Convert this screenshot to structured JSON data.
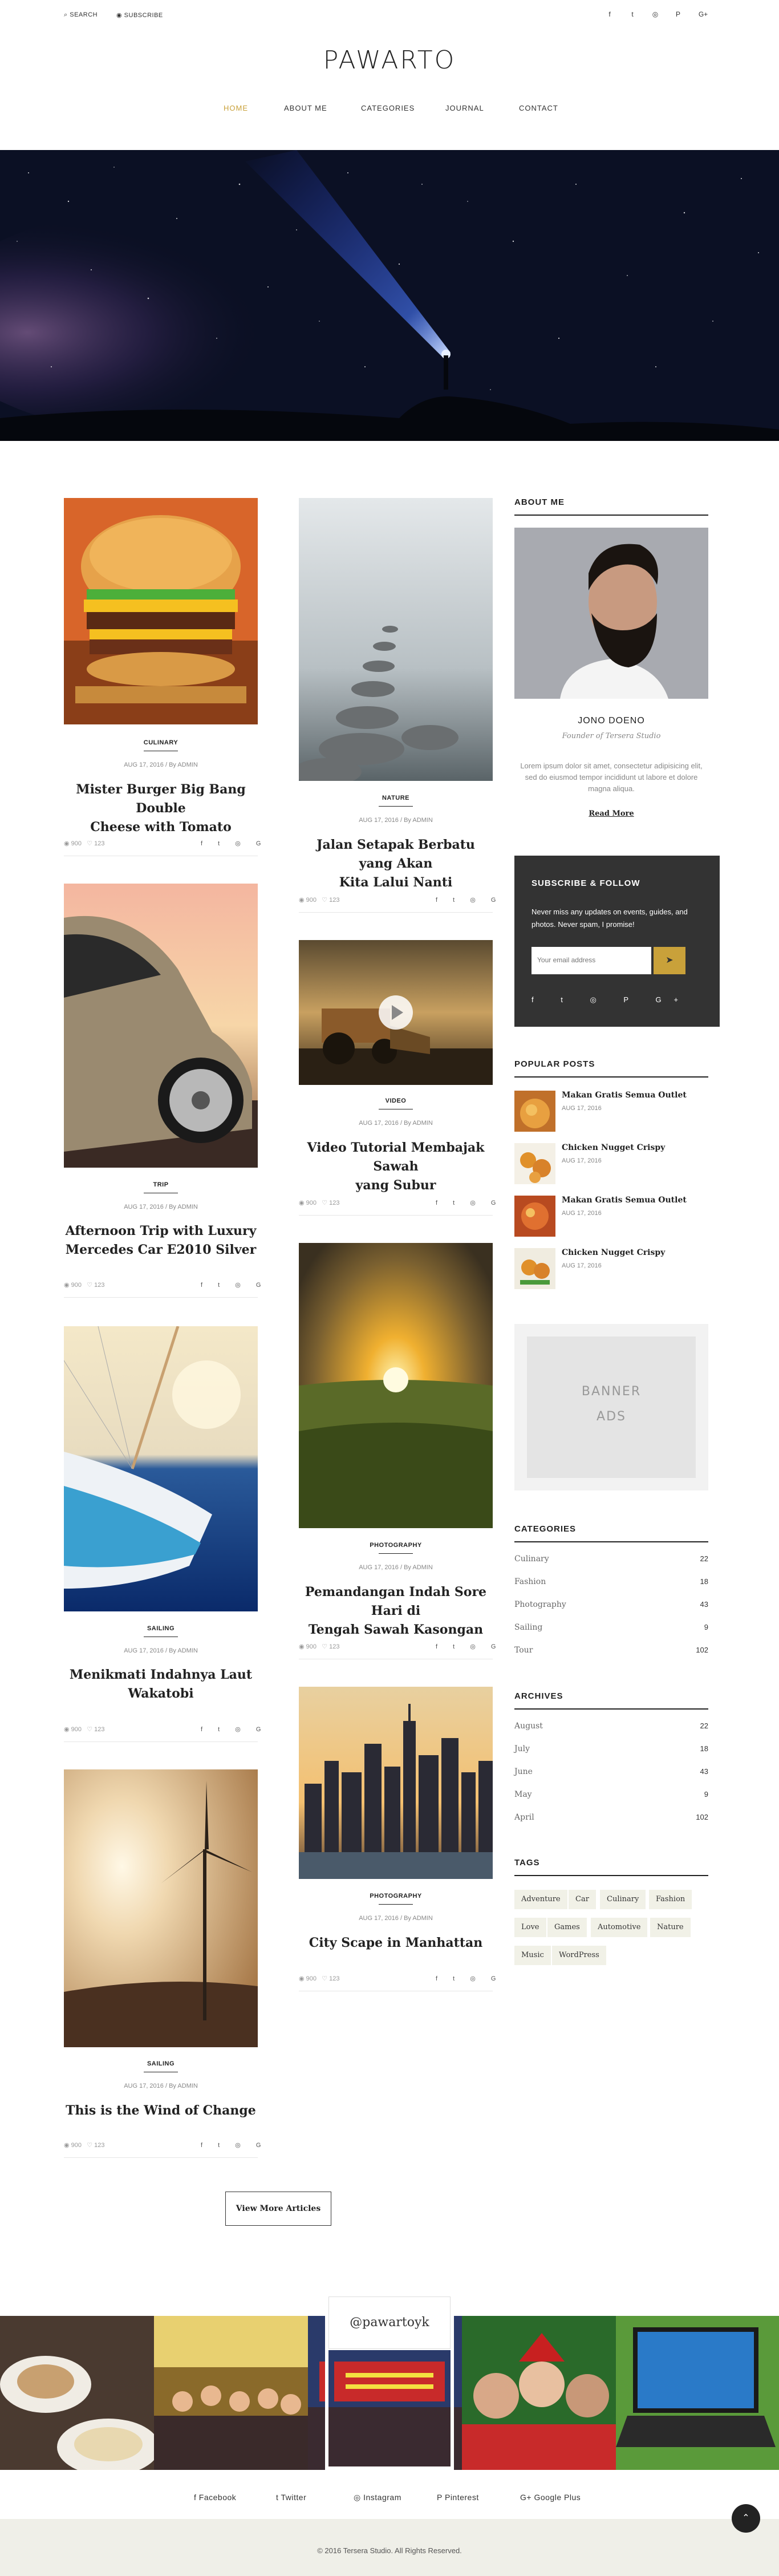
{
  "topbar": {
    "search_label": "SEARCH",
    "subscribe_label": "SUBSCRIBE",
    "social_icons": [
      "facebook-icon",
      "twitter-icon",
      "instagram-icon",
      "pinterest-icon",
      "google-plus-icon"
    ],
    "social_glyphs": [
      "f",
      "t",
      "◎",
      "P",
      "G+"
    ]
  },
  "site": {
    "logo": "PAWARTO"
  },
  "nav": {
    "items": [
      "HOME",
      "ABOUT ME",
      "CATEGORIES",
      "JOURNAL",
      "CONTACT"
    ],
    "active": "HOME"
  },
  "posts": [
    {
      "category": "CULINARY",
      "meta": "AUG 17, 2016 / By ADMIN",
      "title_lines": [
        "Mister Burger Big Bang Double",
        "Cheese with Tomato"
      ],
      "views": "900",
      "likes": "123"
    },
    {
      "category": "NATURE",
      "meta": "AUG 17, 2016 / By ADMIN",
      "title_lines": [
        "Jalan Setapak Berbatu yang Akan",
        "Kita Lalui Nanti"
      ],
      "views": "900",
      "likes": "123"
    },
    {
      "category": "TRIP",
      "meta": "AUG 17, 2016 / By ADMIN",
      "title_lines": [
        "Afternoon Trip with Luxury",
        "Mercedes Car E2010 Silver"
      ],
      "views": "900",
      "likes": "123"
    },
    {
      "category": "VIDEO",
      "meta": "AUG 17, 2016 / By ADMIN",
      "title_lines": [
        "Video Tutorial Membajak Sawah",
        "yang Subur"
      ],
      "views": "900",
      "likes": "123"
    },
    {
      "category": "SAILING",
      "meta": "AUG 17, 2016 / By ADMIN",
      "title_lines": [
        "Menikmati Indahnya Laut",
        "Wakatobi"
      ],
      "views": "900",
      "likes": "123"
    },
    {
      "category": "PHOTOGRAPHY",
      "meta": "AUG 17, 2016 / By ADMIN",
      "title_lines": [
        "Pemandangan Indah Sore Hari di",
        "Tengah Sawah Kasongan"
      ],
      "views": "900",
      "likes": "123"
    },
    {
      "category": "PHOTOGRAPHY",
      "meta": "AUG 17, 2016 / By ADMIN",
      "title_lines": [
        "City Scape in Manhattan",
        ""
      ],
      "views": "900",
      "likes": "123"
    },
    {
      "category": "SAILING",
      "meta": "AUG 17, 2016 / By ADMIN",
      "title_lines": [
        "This is the Wind of Change",
        ""
      ],
      "views": "900",
      "likes": "123"
    }
  ],
  "view_more_label": "View More Articles",
  "sidebar": {
    "about": {
      "title": "ABOUT ME",
      "name": "JONO DOENO",
      "role": "Founder of Tersera Studio",
      "bio": "Lorem ipsum dolor sit amet, consectetur adipisicing elit, sed do eiusmod tempor incididunt ut labore et dolore magna aliqua.",
      "read_more": "Read More"
    },
    "subscribe": {
      "title": "SUBSCRIBE & FOLLOW",
      "text": "Never miss any updates on events, guides, and photos. Never spam, I promise!",
      "placeholder": "Your email address",
      "button_icon": "send-icon"
    },
    "popular": {
      "title": "POPULAR POSTS",
      "items": [
        {
          "title": "Makan Gratis Semua Outlet",
          "date": "AUG 17, 2016"
        },
        {
          "title": "Chicken Nugget Crispy",
          "date": "AUG 17, 2016"
        },
        {
          "title": "Makan Gratis Semua Outlet",
          "date": "AUG 17, 2016"
        },
        {
          "title": "Chicken Nugget Crispy",
          "date": "AUG 17, 2016"
        }
      ]
    },
    "banner": {
      "line1": "BANNER",
      "line2": "ADS"
    },
    "categories": {
      "title": "CATEGORIES",
      "items": [
        {
          "name": "Culinary",
          "count": "22"
        },
        {
          "name": "Fashion",
          "count": "18"
        },
        {
          "name": "Photography",
          "count": "43"
        },
        {
          "name": "Sailing",
          "count": "9"
        },
        {
          "name": "Tour",
          "count": "102"
        }
      ]
    },
    "archives": {
      "title": "ARCHIVES",
      "items": [
        {
          "name": "August",
          "count": "22"
        },
        {
          "name": "July",
          "count": "18"
        },
        {
          "name": "June",
          "count": "43"
        },
        {
          "name": "May",
          "count": "9"
        },
        {
          "name": "April",
          "count": "102"
        }
      ]
    },
    "tags": {
      "title": "TAGS",
      "items": [
        "Adventure",
        "Car",
        "Culinary",
        "Fashion",
        "Love",
        "Games",
        "Automotive",
        "Nature",
        "Music",
        "WordPress"
      ]
    }
  },
  "instagram": {
    "handle": "@pawartoyk"
  },
  "footer": {
    "links": [
      "Facebook",
      "Twitter",
      "Instagram",
      "Pinterest",
      "Google Plus"
    ],
    "copyright": "© 2016 Tersera Studio. All Rights Reserved."
  },
  "colors": {
    "accent": "#c9a13a",
    "dark": "#333333",
    "tag_bg": "#f1f1e7"
  }
}
